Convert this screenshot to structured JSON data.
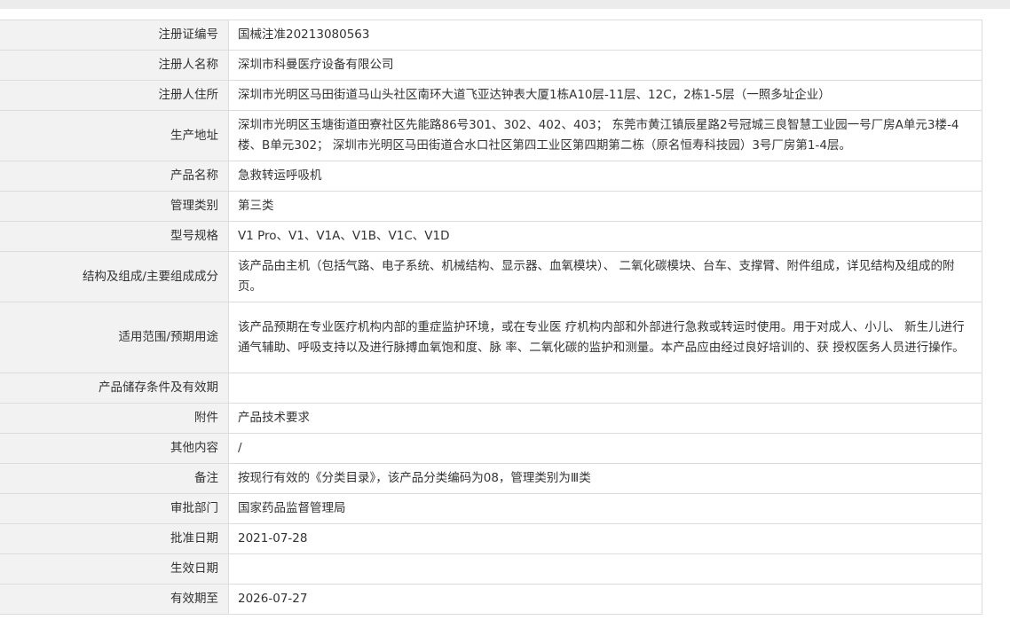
{
  "detail_rows": [
    {
      "label": "注册证编号",
      "value": "国械注准20213080563"
    },
    {
      "label": "注册人名称",
      "value": "深圳市科曼医疗设备有限公司"
    },
    {
      "label": "注册人住所",
      "value": "深圳市光明区马田街道马山头社区南环大道飞亚达钟表大厦1栋A10层-11层、12C，2栋1-5层（一照多址企业）"
    },
    {
      "label": "生产地址",
      "value": "深圳市光明区玉塘街道田寮社区先能路86号301、302、402、403； 东莞市黄江镇辰星路2号冠城三良智慧工业园一号厂房A单元3楼-4楼、B单元302； 深圳市光明区马田街道合水口社区第四工业区第四期第二栋（原名恒寿科技园）3号厂房第1-4层。"
    },
    {
      "label": "产品名称",
      "value": "急救转运呼吸机"
    },
    {
      "label": "管理类别",
      "value": "第三类"
    },
    {
      "label": "型号规格",
      "value": "V1 Pro、V1、V1A、V1B、V1C、V1D"
    },
    {
      "label": "结构及组成/主要组成成分",
      "value": "该产品由主机（包括气路、电子系统、机械结构、显示器、血氧模块）、 二氧化碳模块、台车、支撑臂、附件组成，详见结构及组成的附页。"
    },
    {
      "label": "适用范围/预期用途",
      "value": "该产品预期在专业医疗机构内部的重症监护环境，或在专业医 疗机构内部和外部进行急救或转运时使用。用于对成人、小儿、 新生儿进行通气辅助、呼吸支持以及进行脉搏血氧饱和度、脉 率、二氧化碳的监护和测量。本产品应由经过良好培训的、获 授权医务人员进行操作。"
    },
    {
      "label": "产品储存条件及有效期",
      "value": ""
    },
    {
      "label": "附件",
      "value": "产品技术要求"
    },
    {
      "label": "其他内容",
      "value": "/"
    },
    {
      "label": "备注",
      "value": "按现行有效的《分类目录》，该产品分类编码为08，管理类别为Ⅲ类"
    },
    {
      "label": "审批部门",
      "value": "国家药品监督管理局"
    },
    {
      "label": "批准日期",
      "value": "2021-07-28"
    },
    {
      "label": "生效日期",
      "value": ""
    },
    {
      "label": "有效期至",
      "value": "2026-07-27"
    }
  ]
}
